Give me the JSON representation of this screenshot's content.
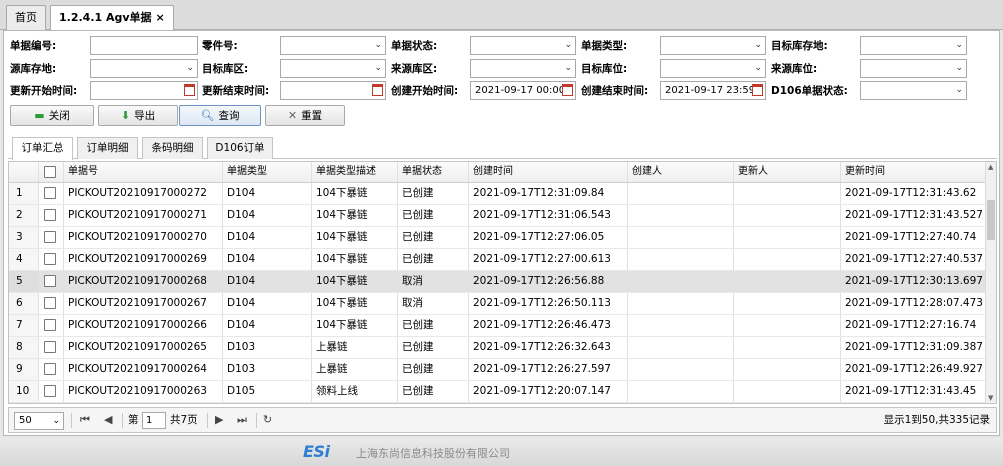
{
  "tabs": [
    {
      "label": "首页"
    },
    {
      "label": "1.2.4.1 Agv单据",
      "close": "×"
    }
  ],
  "form": {
    "row1": [
      {
        "label": "单据编号:",
        "value": ""
      },
      {
        "label": "零件号:",
        "value": ""
      },
      {
        "label": "单据状态:",
        "value": ""
      },
      {
        "label": "单据类型:",
        "value": ""
      },
      {
        "label": "目标库存地:",
        "value": ""
      }
    ],
    "row2": [
      {
        "label": "源库存地:",
        "value": ""
      },
      {
        "label": "目标库区:",
        "value": ""
      },
      {
        "label": "来源库区:",
        "value": ""
      },
      {
        "label": "目标库位:",
        "value": ""
      },
      {
        "label": "来源库位:",
        "value": ""
      }
    ],
    "row3": [
      {
        "label": "更新开始时间:",
        "value": ""
      },
      {
        "label": "更新结束时间:",
        "value": ""
      },
      {
        "label": "创建开始时间:",
        "value": "2021-09-17 00:00"
      },
      {
        "label": "创建结束时间:",
        "value": "2021-09-17 23:59"
      },
      {
        "label": "D106单据状态:",
        "value": ""
      }
    ]
  },
  "buttons": {
    "close": "关闭",
    "export": "导出",
    "query": "查询",
    "reset": "重置"
  },
  "subtabs": [
    "订单汇总",
    "订单明细",
    "条码明细",
    "D106订单"
  ],
  "grid": {
    "columns": [
      "单据号",
      "单据类型",
      "单据类型描述",
      "单据状态",
      "创建时间",
      "创建人",
      "更新人",
      "更新时间"
    ],
    "rows": [
      {
        "n": "1",
        "no": "PICKOUT20210917000272",
        "type": "D104",
        "desc": "104下暴链",
        "status": "已创建",
        "created": "2021-09-17T12:31:09.84",
        "creator": "",
        "updater": "",
        "updated": "2021-09-17T12:31:43.62"
      },
      {
        "n": "2",
        "no": "PICKOUT20210917000271",
        "type": "D104",
        "desc": "104下暴链",
        "status": "已创建",
        "created": "2021-09-17T12:31:06.543",
        "creator": "",
        "updater": "",
        "updated": "2021-09-17T12:31:43.527"
      },
      {
        "n": "3",
        "no": "PICKOUT20210917000270",
        "type": "D104",
        "desc": "104下暴链",
        "status": "已创建",
        "created": "2021-09-17T12:27:06.05",
        "creator": "",
        "updater": "",
        "updated": "2021-09-17T12:27:40.74"
      },
      {
        "n": "4",
        "no": "PICKOUT20210917000269",
        "type": "D104",
        "desc": "104下暴链",
        "status": "已创建",
        "created": "2021-09-17T12:27:00.613",
        "creator": "",
        "updater": "",
        "updated": "2021-09-17T12:27:40.537"
      },
      {
        "n": "5",
        "no": "PICKOUT20210917000268",
        "type": "D104",
        "desc": "104下暴链",
        "status": "取消",
        "created": "2021-09-17T12:26:56.88",
        "creator": "",
        "updater": "",
        "updated": "2021-09-17T12:30:13.697"
      },
      {
        "n": "6",
        "no": "PICKOUT20210917000267",
        "type": "D104",
        "desc": "104下暴链",
        "status": "取消",
        "created": "2021-09-17T12:26:50.113",
        "creator": "",
        "updater": "",
        "updated": "2021-09-17T12:28:07.473"
      },
      {
        "n": "7",
        "no": "PICKOUT20210917000266",
        "type": "D104",
        "desc": "104下暴链",
        "status": "已创建",
        "created": "2021-09-17T12:26:46.473",
        "creator": "",
        "updater": "",
        "updated": "2021-09-17T12:27:16.74"
      },
      {
        "n": "8",
        "no": "PICKOUT20210917000265",
        "type": "D103",
        "desc": "上暴链",
        "status": "已创建",
        "created": "2021-09-17T12:26:32.643",
        "creator": "",
        "updater": "",
        "updated": "2021-09-17T12:31:09.387"
      },
      {
        "n": "9",
        "no": "PICKOUT20210917000264",
        "type": "D103",
        "desc": "上暴链",
        "status": "已创建",
        "created": "2021-09-17T12:26:27.597",
        "creator": "",
        "updater": "",
        "updated": "2021-09-17T12:26:49.927"
      },
      {
        "n": "10",
        "no": "PICKOUT20210917000263",
        "type": "D105",
        "desc": "领料上线",
        "status": "已创建",
        "created": "2021-09-17T12:20:07.147",
        "creator": "",
        "updater": "",
        "updated": "2021-09-17T12:31:43.45"
      }
    ]
  },
  "pager": {
    "page_size": "50",
    "page_prefix": "第",
    "page_value": "1",
    "page_total": "共7页",
    "summary": "显示1到50,共335记录"
  },
  "footer": {
    "logo": "ESi",
    "company": "上海东尚信息科技股份有限公司"
  },
  "colors": {
    "logo": "#2e7fd4",
    "selected_row": "#e2e2e2"
  }
}
